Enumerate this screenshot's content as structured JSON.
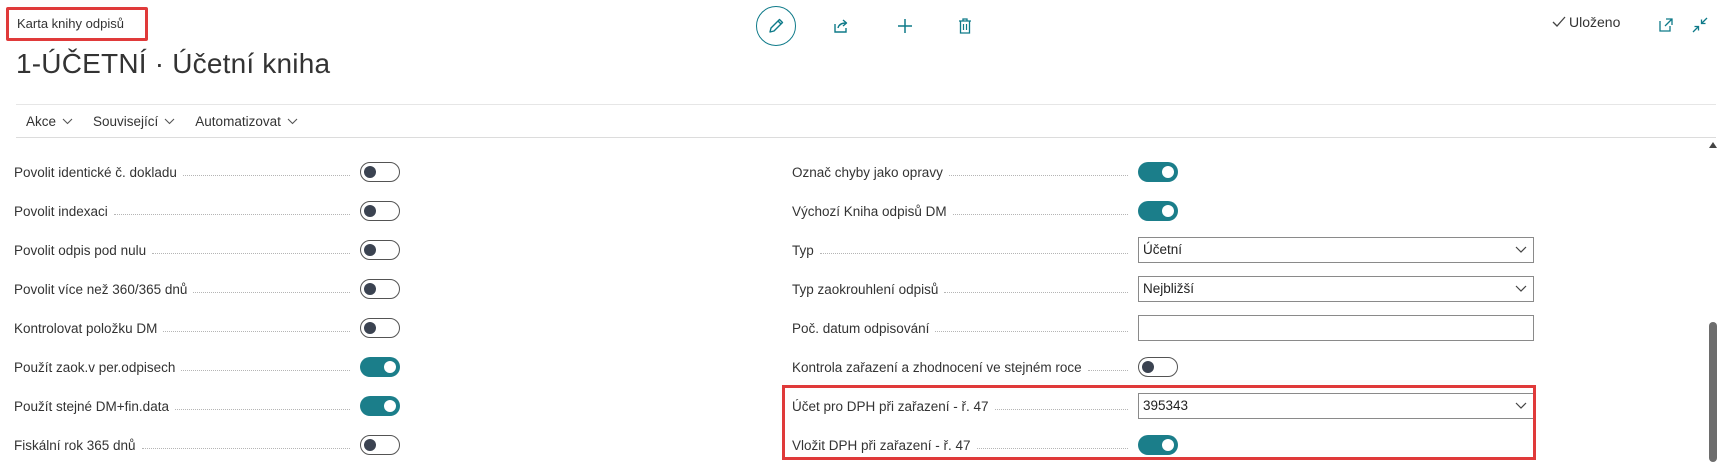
{
  "header": {
    "page_type": "Karta knihy odpisů",
    "title": "1-ÚČETNÍ · Účetní kniha",
    "status": "Uloženo"
  },
  "toolbar": {
    "icons": [
      "edit-icon",
      "share-icon",
      "add-icon",
      "delete-icon"
    ],
    "window_icons": [
      "popout-icon",
      "collapse-icon"
    ]
  },
  "actions": [
    {
      "label": "Akce"
    },
    {
      "label": "Související"
    },
    {
      "label": "Automatizovat"
    }
  ],
  "left_fields": [
    {
      "label": "Povolit identické č. dokladu",
      "value": false
    },
    {
      "label": "Povolit indexaci",
      "value": false
    },
    {
      "label": "Povolit odpis pod nulu",
      "value": false
    },
    {
      "label": "Povolit více než 360/365 dnů",
      "value": false
    },
    {
      "label": "Kontrolovat položku DM",
      "value": false
    },
    {
      "label": "Použít zaok.v per.odpisech",
      "value": true
    },
    {
      "label": "Použít stejné DM+fin.data",
      "value": true
    },
    {
      "label": "Fiskální rok 365 dnů",
      "value": false
    }
  ],
  "right_fields": [
    {
      "label": "Označ chyby jako opravy",
      "type": "toggle",
      "value": true
    },
    {
      "label": "Výchozí Kniha odpisů DM",
      "type": "toggle",
      "value": true
    },
    {
      "label": "Typ",
      "type": "select",
      "value": "Účetní"
    },
    {
      "label": "Typ zaokrouhlení odpisů",
      "type": "select",
      "value": "Nejbližší"
    },
    {
      "label": "Poč. datum odpisování",
      "type": "text",
      "value": ""
    },
    {
      "label": "Kontrola zařazení a zhodnocení ve stejném roce",
      "type": "toggle",
      "value": false
    },
    {
      "label": "Účet pro DPH při zařazení - ř. 47",
      "type": "select",
      "value": "395343"
    },
    {
      "label": "Vložit DPH při zařazení - ř. 47",
      "type": "toggle",
      "value": true
    }
  ],
  "colors": {
    "accent": "#1b7e8a",
    "highlight": "#e03a3a"
  }
}
